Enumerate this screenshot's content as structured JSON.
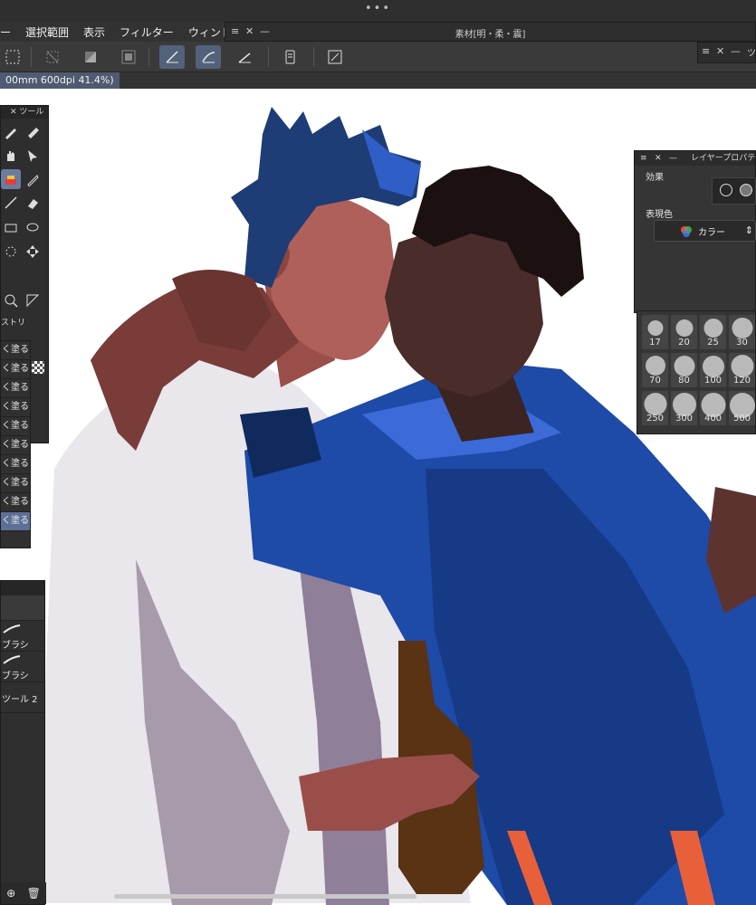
{
  "menubar": {
    "items": [
      "ー",
      "選択範囲",
      "表示",
      "フィルター",
      "ウィンド"
    ]
  },
  "material_panel": {
    "title": "素材[明・柔・震]"
  },
  "mini_panel": {
    "label": "ツ"
  },
  "document": {
    "tab_label": "00mm 600dpi 41.4%)"
  },
  "tool_panel": {
    "title": "ツール",
    "sub_tool_partial": "ストリ",
    "sub_tools": [
      "く塗る",
      "く塗る",
      "く塗る",
      "く塗る",
      "く塗る",
      "く塗る",
      "く塗る",
      "く塗る",
      "く塗る",
      "く塗る"
    ]
  },
  "brush_panel": {
    "items": [
      "ブラシ",
      "ブラシ",
      "ツール 2"
    ]
  },
  "layer_property": {
    "title": "レイヤープロパテ",
    "effect_label": "効果",
    "express_color_label": "表現色",
    "express_color_value": "カラー"
  },
  "brush_sizes": [
    "17",
    "20",
    "25",
    "30",
    "70",
    "80",
    "100",
    "120",
    "250",
    "300",
    "400",
    "500"
  ],
  "colors": {
    "accent": "#5d7097",
    "panel_bg": "#2e2e2e",
    "canvas": "#ffffff"
  }
}
